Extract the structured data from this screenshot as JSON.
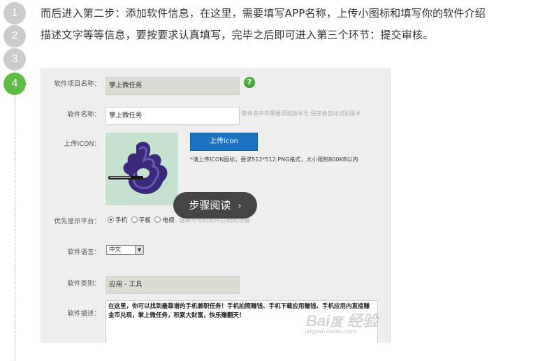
{
  "steps": [
    "1",
    "2",
    "3",
    "4"
  ],
  "active_step": "4",
  "paragraph": "而后进入第二步：添加软件信息，在这里，需要填写APP名称，上传小图标和填写你的软件介绍描述文字等等信息，要按要求认真填写，完毕之后即可进入第三个环节：提交审核。",
  "form": {
    "project_name_label": "软件项目名称：",
    "project_name_value": "掌上微任务",
    "help_icon": "?",
    "app_name_label": "软件名称：",
    "app_name_value": "掌上微任务",
    "app_name_hint": "软件名中不需要添加版本号,程序会自动识别版本",
    "upload_icon_label": "上传ICON：",
    "upload_button": "上传icon",
    "upload_note": "*请上传ICON图标，要求512*512,PNG格式，大小限制800KB以内",
    "platform_label": "优先显示平台：",
    "platform_options": [
      "手机",
      "平板",
      "电视"
    ],
    "platform_selected": "手机",
    "platform_hint": "选择与你的软件匹配的设备",
    "language_label": "软件语言：",
    "language_value": "中文",
    "category_label": "软件类别：",
    "category_value": "应用 - 工具",
    "description_label": "软件描述：",
    "description_value": "在这里，你可以找到最靠谱的手机兼职任务！手机拍照赚钱、手机下载应用赚钱、手机应用内直接赚金币兑现，掌上微任务，积累大财富，快乐赚翻天！"
  },
  "watermark": "Baidu经验",
  "watermark_sub": "jingyan.baidu.com",
  "overlay": {
    "label": "步骤阅读",
    "chevron": "›"
  },
  "colors": {
    "step_inactive": "#cccccc",
    "step_active": "#5cbd42",
    "upload_button": "#1e73c2"
  }
}
